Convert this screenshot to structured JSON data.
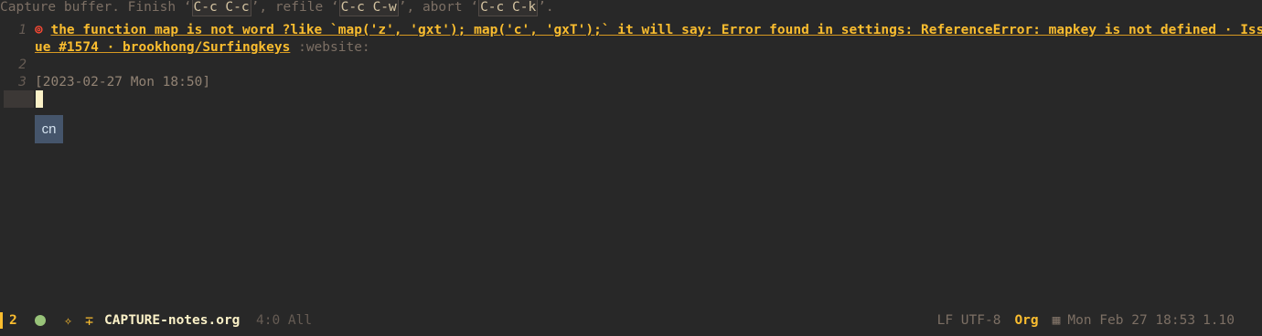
{
  "header": {
    "prefix": "Capture buffer.  Finish ‘",
    "finish_key": "C-c C-c",
    "mid1": "’, refile ‘",
    "refile_key": "C-c C-w",
    "mid2": "’, abort ‘",
    "abort_key": "C-c C-k",
    "suffix": "’."
  },
  "lines": [
    {
      "num": "1",
      "bullet": "⊚",
      "link_text": "the function map is not word ?like `map('z', 'gxt'); map('c', 'gxT');` it will say: Error found in settings: ReferenceError: mapkey is not defined · Iss",
      "continuation": "ue #1574 · brookhong/Surfingkeys",
      "tag": ":website:"
    },
    {
      "num": "2",
      "text": ""
    },
    {
      "num": "3",
      "text": "[2023-02-27 Mon 18:50]"
    }
  ],
  "input_method": "cn",
  "modeline": {
    "workspace": "2",
    "buffer_name": "CAPTURE-notes.org",
    "position": "4:0 All",
    "encoding": "LF UTF-8",
    "mode": "Org",
    "datetime": "Mon Feb 27 18:53",
    "load": "1.10"
  },
  "colors": {
    "background": "#282828",
    "accent": "#fabd2f",
    "status_dot": "#98c379",
    "input_method_bg": "#45556b"
  }
}
